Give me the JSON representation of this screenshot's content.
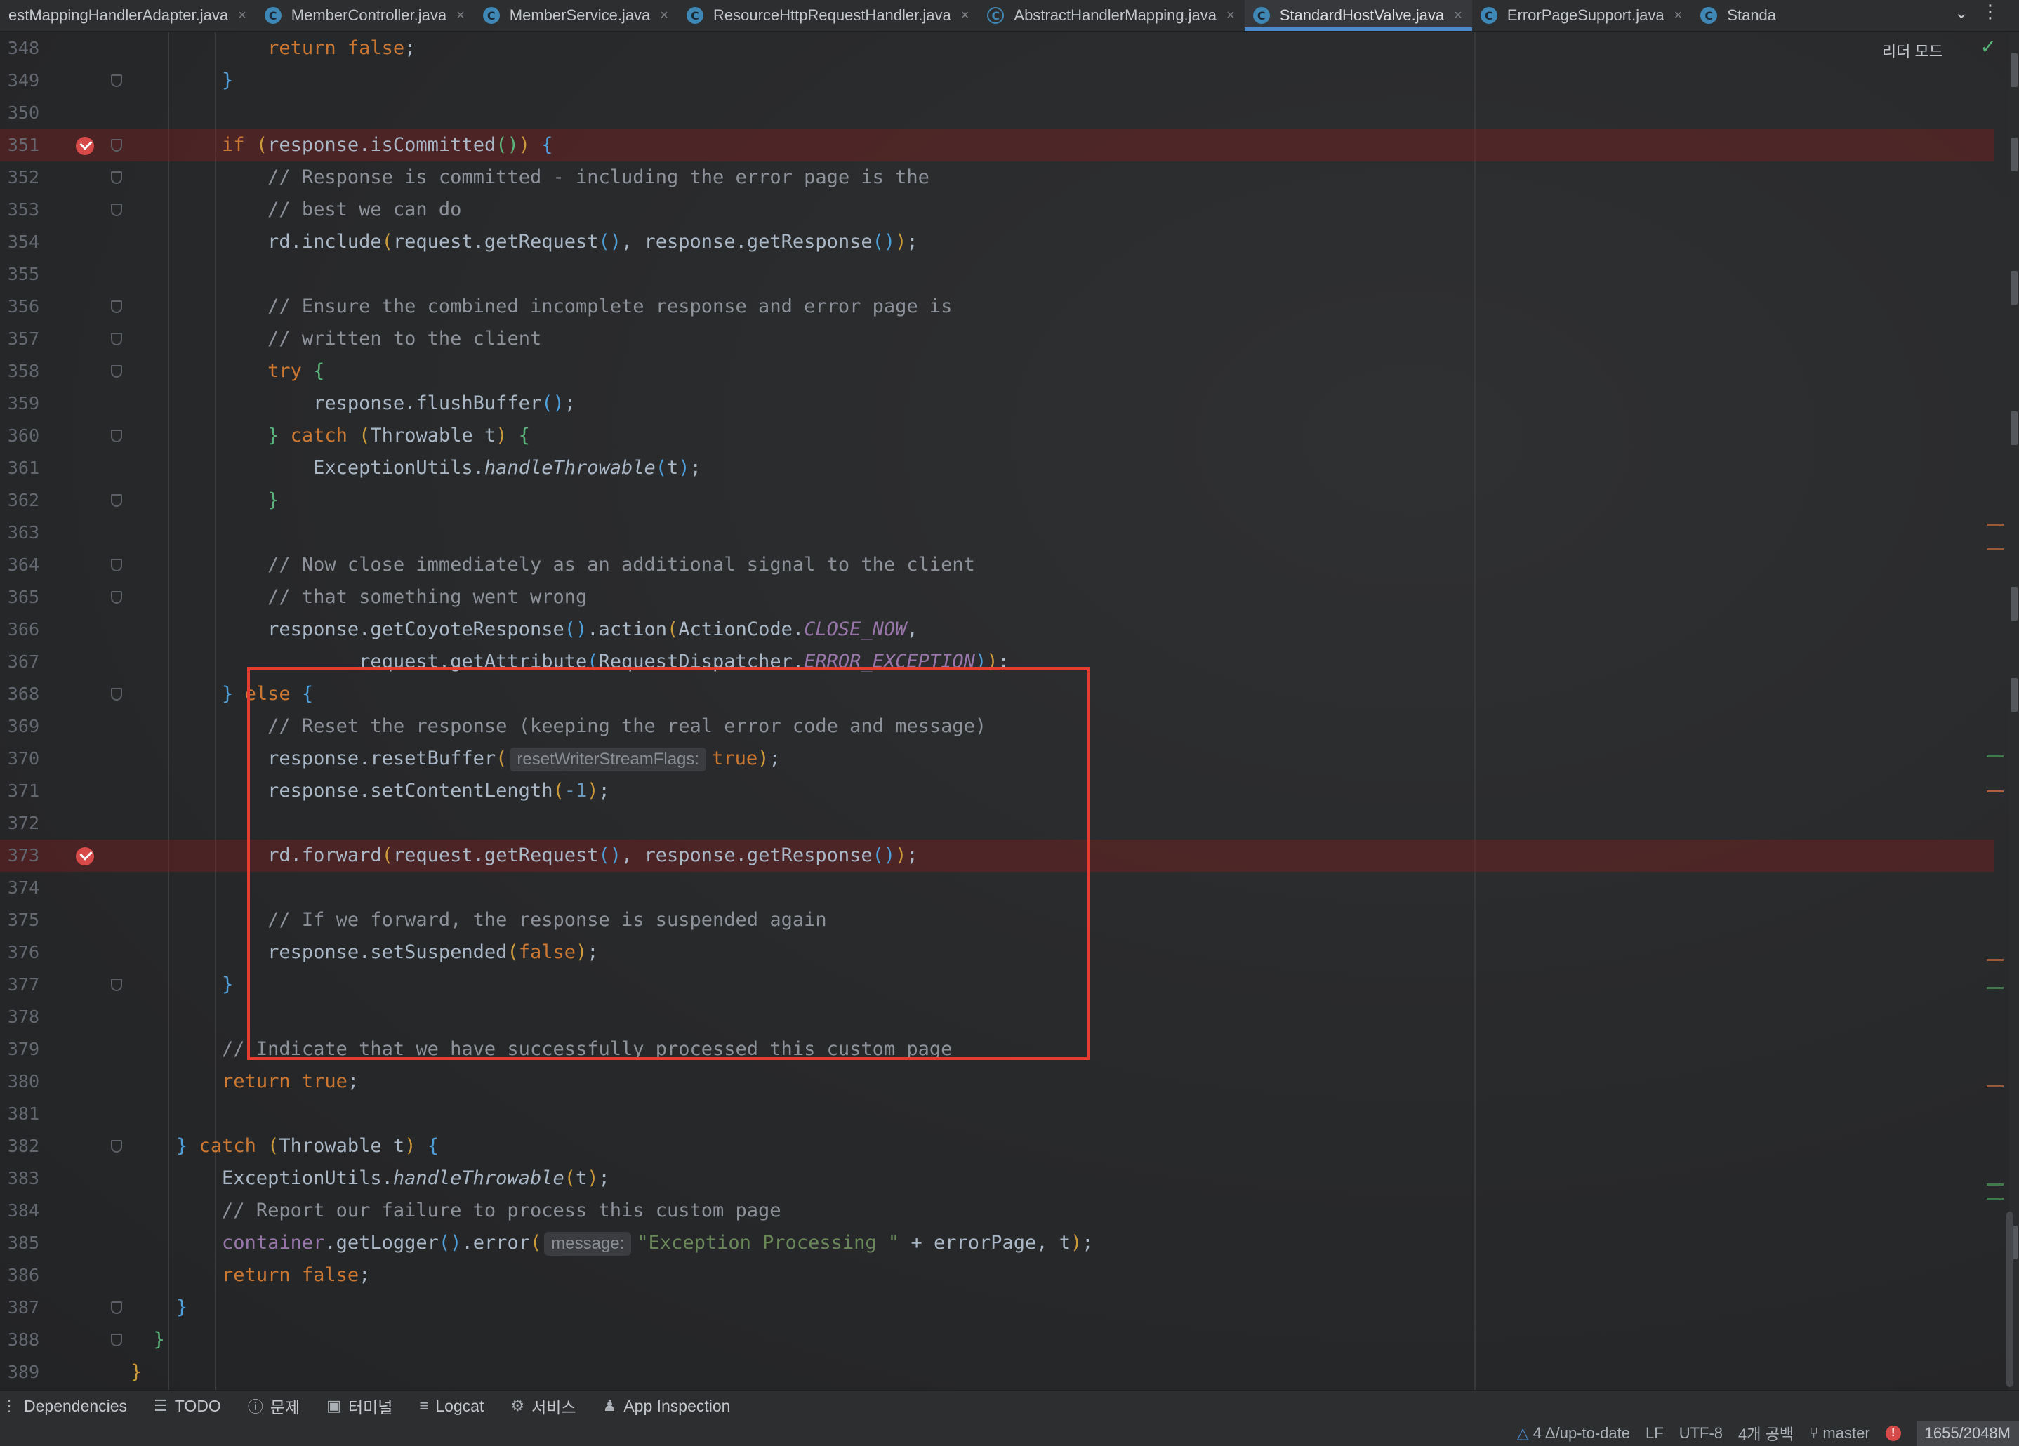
{
  "tabs": [
    {
      "label": "estMappingHandlerAdapter.java",
      "icon": "class-icon",
      "active": false,
      "has_icon": false
    },
    {
      "label": "MemberController.java",
      "icon": "class-icon",
      "active": false,
      "has_icon": true
    },
    {
      "label": "MemberService.java",
      "icon": "class-icon",
      "active": false,
      "has_icon": true
    },
    {
      "label": "ResourceHttpRequestHandler.java",
      "icon": "class-icon",
      "active": false,
      "has_icon": true
    },
    {
      "label": "AbstractHandlerMapping.java",
      "icon": "abstract-class-icon",
      "active": false,
      "has_icon": true
    },
    {
      "label": "StandardHostValve.java",
      "icon": "class-icon",
      "active": true,
      "has_icon": true
    },
    {
      "label": "ErrorPageSupport.java",
      "icon": "class-icon",
      "active": false,
      "has_icon": true
    },
    {
      "label": "Standa",
      "icon": "class-icon",
      "active": false,
      "has_icon": true
    }
  ],
  "editor": {
    "reader_mode": "리더 모드",
    "lines": [
      {
        "n": "348",
        "bp": false,
        "fold": false,
        "html": "            <span class=\"kw\">return false</span>;"
      },
      {
        "n": "349",
        "bp": false,
        "fold": true,
        "html": "        <span class=\"br\">}</span>"
      },
      {
        "n": "350",
        "bp": false,
        "fold": false,
        "html": ""
      },
      {
        "n": "351",
        "bp": true,
        "fold": true,
        "html": "        <span class=\"kw\">if</span> <span class=\"br2\">(</span>response.isCommitted<span class=\"br3\">()</span><span class=\"br2\">)</span> <span class=\"br\">{</span>"
      },
      {
        "n": "352",
        "bp": false,
        "fold": true,
        "html": "            <span class=\"cm\">// Response is committed - including the error page is the</span>"
      },
      {
        "n": "353",
        "bp": false,
        "fold": true,
        "html": "            <span class=\"cm\">// best we can do</span>"
      },
      {
        "n": "354",
        "bp": false,
        "fold": false,
        "html": "            rd.include<span class=\"br2\">(</span>request.getRequest<span class=\"br\">()</span>, response.getResponse<span class=\"br\">()</span><span class=\"br2\">)</span>;"
      },
      {
        "n": "355",
        "bp": false,
        "fold": false,
        "html": ""
      },
      {
        "n": "356",
        "bp": false,
        "fold": true,
        "html": "            <span class=\"cm\">// Ensure the combined incomplete response and error page is</span>"
      },
      {
        "n": "357",
        "bp": false,
        "fold": true,
        "html": "            <span class=\"cm\">// written to the client</span>"
      },
      {
        "n": "358",
        "bp": false,
        "fold": true,
        "html": "            <span class=\"kw\">try</span> <span class=\"br3\">{</span>"
      },
      {
        "n": "359",
        "bp": false,
        "fold": false,
        "html": "                response.flushBuffer<span class=\"br\">()</span>;"
      },
      {
        "n": "360",
        "bp": false,
        "fold": true,
        "html": "            <span class=\"br3\">}</span> <span class=\"kw\">catch</span> <span class=\"br2\">(</span>Throwable t<span class=\"br2\">)</span> <span class=\"br3\">{</span>"
      },
      {
        "n": "361",
        "bp": false,
        "fold": false,
        "html": "                ExceptionUtils.<span class=\"it\">handleThrowable</span><span class=\"br\">(</span>t<span class=\"br\">)</span>;"
      },
      {
        "n": "362",
        "bp": false,
        "fold": true,
        "html": "            <span class=\"br3\">}</span>"
      },
      {
        "n": "363",
        "bp": false,
        "fold": false,
        "html": ""
      },
      {
        "n": "364",
        "bp": false,
        "fold": true,
        "html": "            <span class=\"cm\">// Now close immediately as an additional signal to the client</span>"
      },
      {
        "n": "365",
        "bp": false,
        "fold": true,
        "html": "            <span class=\"cm\">// that something went wrong</span>"
      },
      {
        "n": "366",
        "bp": false,
        "fold": false,
        "html": "            response.getCoyoteResponse<span class=\"br\">()</span>.action<span class=\"br2\">(</span>ActionCode.<span class=\"cn\">CLOSE_NOW</span>,"
      },
      {
        "n": "367",
        "bp": false,
        "fold": false,
        "html": "                    request.getAttribute<span class=\"br\">(</span>RequestDispatcher.<span class=\"cn\">ERROR_EXCEPTION</span><span class=\"br\">)</span><span class=\"br2\">)</span>;"
      },
      {
        "n": "368",
        "bp": false,
        "fold": true,
        "html": "        <span class=\"br\">}</span> <span class=\"kw\">else</span> <span class=\"br\">{</span>"
      },
      {
        "n": "369",
        "bp": false,
        "fold": false,
        "html": "            <span class=\"cm\">// Reset the response (keeping the real error code and message)</span>"
      },
      {
        "n": "370",
        "bp": false,
        "fold": false,
        "html": "            response.resetBuffer<span class=\"br2\">(</span><span class=\"hint\">resetWriterStreamFlags:</span><span class=\"kw\">true</span><span class=\"br2\">)</span>;"
      },
      {
        "n": "371",
        "bp": false,
        "fold": false,
        "html": "            response.setContentLength<span class=\"br2\">(</span><span class=\"nm\">-1</span><span class=\"br2\">)</span>;"
      },
      {
        "n": "372",
        "bp": false,
        "fold": false,
        "html": ""
      },
      {
        "n": "373",
        "bp": true,
        "fold": false,
        "html": "            rd.forward<span class=\"br2\">(</span>request.getRequest<span class=\"br\">()</span>, response.getResponse<span class=\"br\">()</span><span class=\"br2\">)</span>;"
      },
      {
        "n": "374",
        "bp": false,
        "fold": false,
        "html": ""
      },
      {
        "n": "375",
        "bp": false,
        "fold": false,
        "html": "            <span class=\"cm\">// If we forward, the response is suspended again</span>"
      },
      {
        "n": "376",
        "bp": false,
        "fold": false,
        "html": "            response.setSuspended<span class=\"br2\">(</span><span class=\"kw\">false</span><span class=\"br2\">)</span>;"
      },
      {
        "n": "377",
        "bp": false,
        "fold": true,
        "html": "        <span class=\"br\">}</span>"
      },
      {
        "n": "378",
        "bp": false,
        "fold": false,
        "html": ""
      },
      {
        "n": "379",
        "bp": false,
        "fold": false,
        "html": "        <span class=\"cm\">// Indicate that we have successfully processed this custom page</span>"
      },
      {
        "n": "380",
        "bp": false,
        "fold": false,
        "html": "        <span class=\"kw\">return true</span>;"
      },
      {
        "n": "381",
        "bp": false,
        "fold": false,
        "html": ""
      },
      {
        "n": "382",
        "bp": false,
        "fold": true,
        "html": "    <span class=\"br\">}</span> <span class=\"kw\">catch</span> <span class=\"br2\">(</span>Throwable t<span class=\"br2\">)</span> <span class=\"br\">{</span>"
      },
      {
        "n": "383",
        "bp": false,
        "fold": false,
        "html": "        ExceptionUtils.<span class=\"it\">handleThrowable</span><span class=\"br2\">(</span>t<span class=\"br2\">)</span>;"
      },
      {
        "n": "384",
        "bp": false,
        "fold": false,
        "html": "        <span class=\"cm\">// Report our failure to process this custom page</span>"
      },
      {
        "n": "385",
        "bp": false,
        "fold": false,
        "html": "        <span class=\"fd\">container</span>.getLogger<span class=\"br\">()</span>.error<span class=\"br2\">(</span><span class=\"hint\">message:</span><span class=\"st\">\"Exception Processing \"</span> + errorPage, t<span class=\"br2\">)</span>;"
      },
      {
        "n": "386",
        "bp": false,
        "fold": false,
        "html": "        <span class=\"kw\">return false</span>;"
      },
      {
        "n": "387",
        "bp": false,
        "fold": true,
        "html": "    <span class=\"br\">}</span>"
      },
      {
        "n": "388",
        "bp": false,
        "fold": true,
        "html": "  <span class=\"br3\">}</span>"
      },
      {
        "n": "389",
        "bp": false,
        "fold": false,
        "html": "<span class=\"br2\">}</span>"
      }
    ]
  },
  "tool_windows": [
    {
      "label": "Dependencies",
      "icon": "dependencies-icon",
      "glyph": "⋮"
    },
    {
      "label": "TODO",
      "icon": "todo-icon",
      "glyph": "☰"
    },
    {
      "label": "문제",
      "icon": "problems-icon",
      "glyph": "ⓘ"
    },
    {
      "label": "터미널",
      "icon": "terminal-icon",
      "glyph": "▣"
    },
    {
      "label": "Logcat",
      "icon": "logcat-icon",
      "glyph": "≡"
    },
    {
      "label": "서비스",
      "icon": "services-icon",
      "glyph": "⚙"
    },
    {
      "label": "App Inspection",
      "icon": "app-inspection-icon",
      "glyph": "♟"
    }
  ],
  "status": {
    "vcs_status": "4 Δ/up-to-date",
    "line_separator": "LF",
    "encoding": "UTF-8",
    "indent": "4개 공백",
    "branch": "master",
    "memory": "1655/2048M"
  },
  "colors": {
    "accent": "#4a88c7",
    "breakpoint": "#d64a4a",
    "highlight_box": "#e43d30"
  }
}
